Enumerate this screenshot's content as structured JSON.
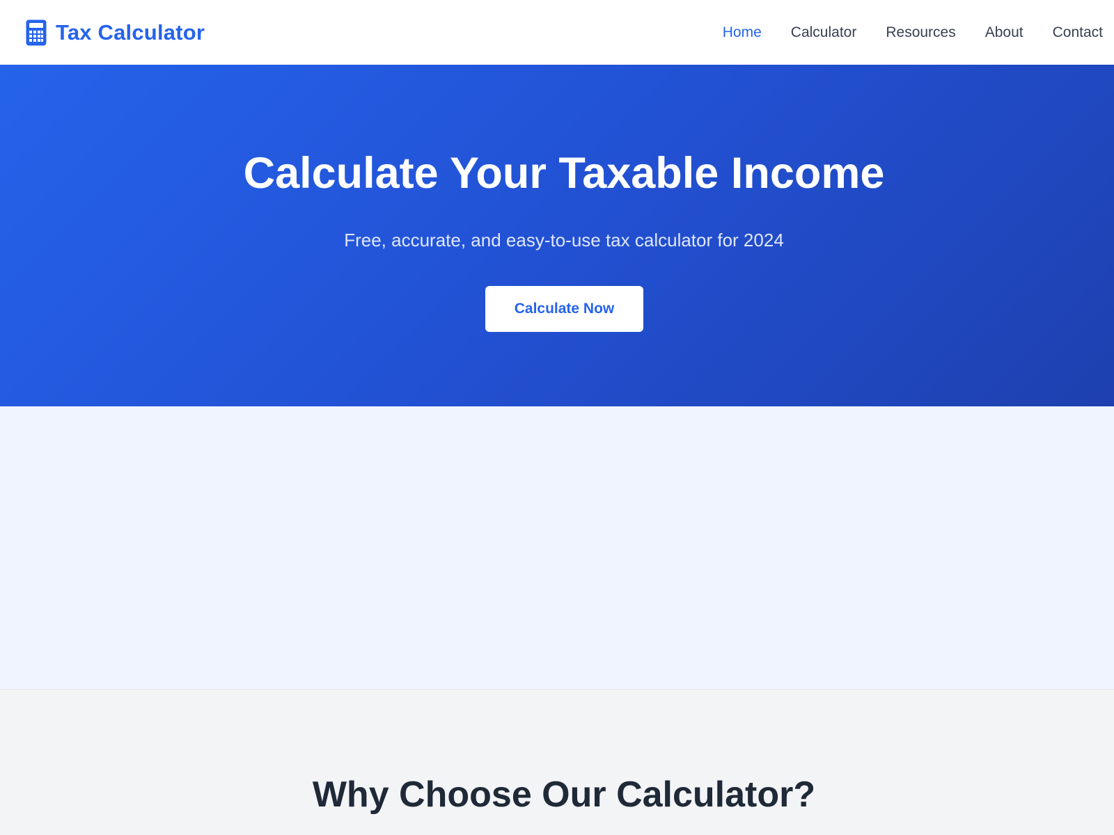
{
  "brand": {
    "name": "Tax Calculator",
    "icon": "calculator-icon"
  },
  "nav": {
    "items": [
      {
        "label": "Home",
        "active": true
      },
      {
        "label": "Calculator",
        "active": false
      },
      {
        "label": "Resources",
        "active": false
      },
      {
        "label": "About",
        "active": false
      },
      {
        "label": "Contact",
        "active": false
      }
    ]
  },
  "hero": {
    "title": "Calculate Your Taxable Income",
    "subtitle": "Free, accurate, and easy-to-use tax calculator for 2024",
    "cta_label": "Calculate Now"
  },
  "features": {
    "title": "Why Choose Our Calculator?"
  },
  "colors": {
    "brand": "#2563eb",
    "hero_gradient_start": "#2563eb",
    "hero_gradient_end": "#1e40af",
    "nav_text": "#374151",
    "heading_dark": "#1f2937",
    "section_light": "#eff4fe",
    "section_gray": "#f3f4f6"
  }
}
